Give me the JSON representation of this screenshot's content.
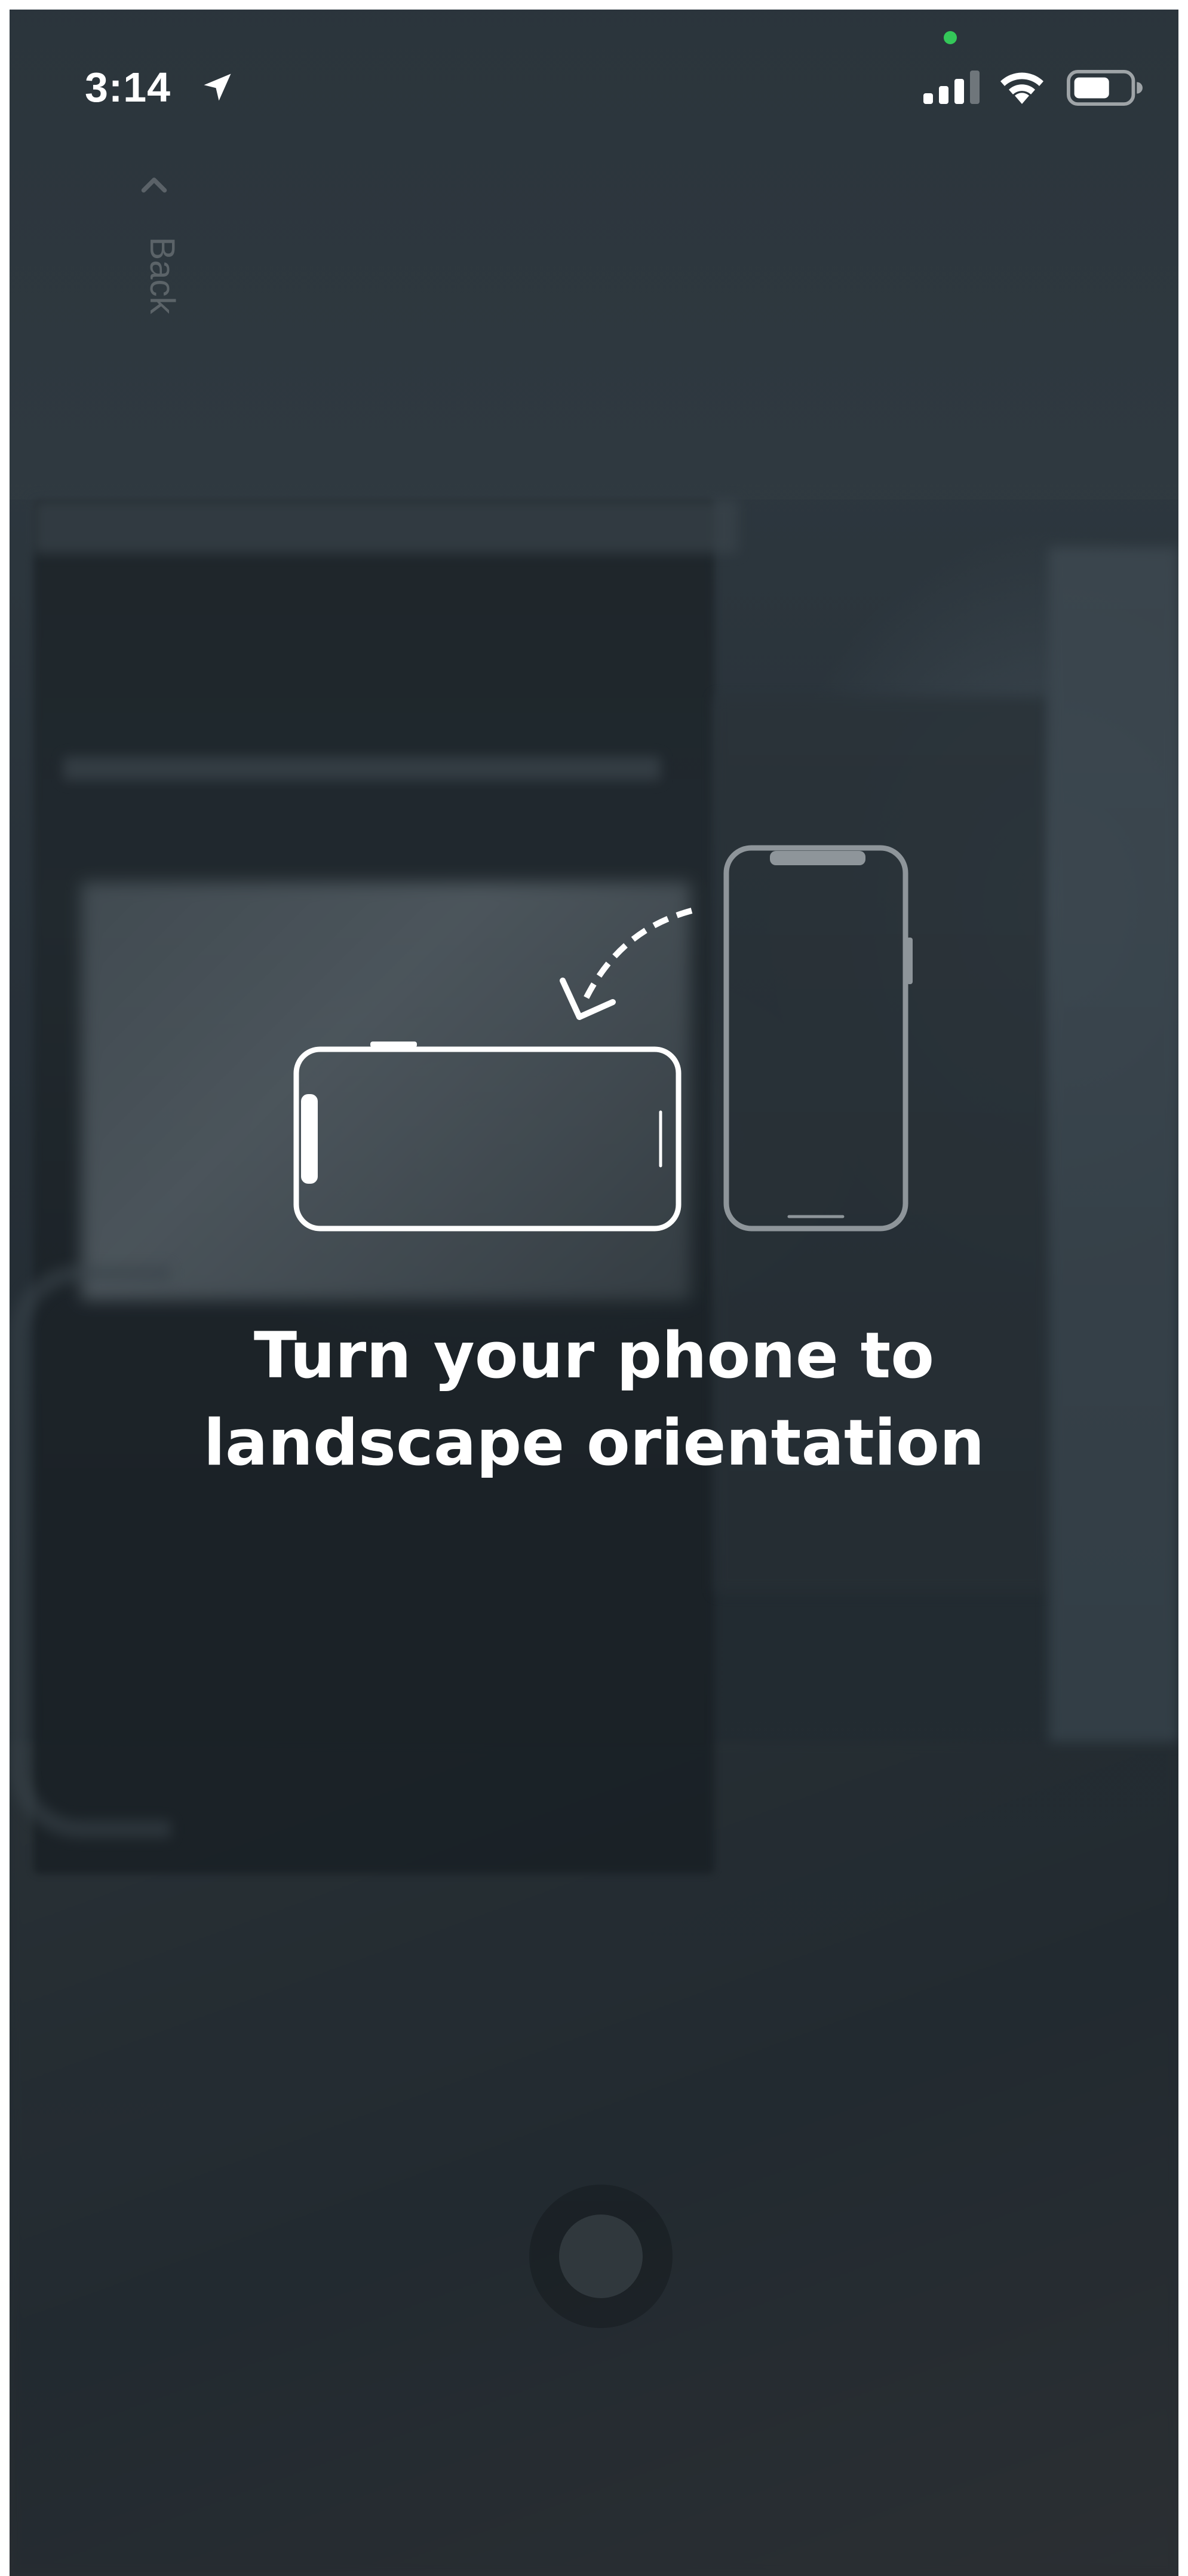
{
  "status_bar": {
    "time": "3:14",
    "location_icon": "location-arrow-icon",
    "signal_icon": "cellular-signal-icon",
    "wifi_icon": "wifi-icon",
    "battery_icon": "battery-icon",
    "privacy_indicator_color": "#34c759"
  },
  "back": {
    "label": "Back",
    "icon": "chevron-left-icon"
  },
  "illustration": {
    "landscape_phone_icon": "landscape-phone-icon",
    "portrait_phone_icon": "portrait-phone-icon",
    "rotate_arrow_icon": "curved-arrow-icon"
  },
  "message": {
    "line1": "Turn your phone to",
    "line2": "landscape orientation"
  },
  "capture": {
    "icon": "shutter-button-icon"
  },
  "colors": {
    "text": "#ffffff",
    "overlay": "#2a3238",
    "portrait_phone_outline": "#8e959a"
  }
}
